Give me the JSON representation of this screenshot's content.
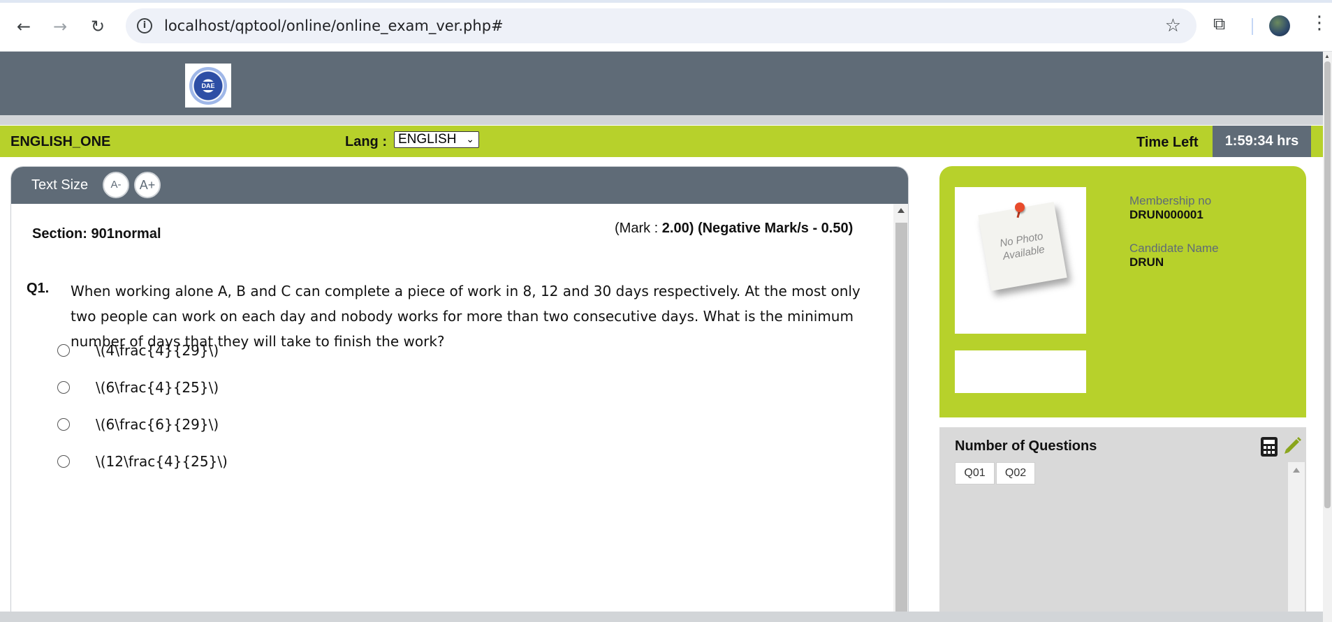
{
  "browser": {
    "url": "localhost/qptool/online/online_exam_ver.php#"
  },
  "header": {
    "logo_text": "DAE"
  },
  "exam_bar": {
    "exam_name": "ENGLISH_ONE",
    "lang_label": "Lang :",
    "lang_value": "ENGLISH",
    "time_left_label": "Time Left",
    "time_left_value": "1:59:34 hrs"
  },
  "question_panel": {
    "text_size_label": "Text Size",
    "decrease_label": "A-",
    "increase_label": "A+",
    "section": "Section: 901normal",
    "mark_prefix": "(Mark : ",
    "mark_value": "2.00)",
    "negative_mark": "(Negative Mark/s - 0.50)",
    "question_number": "Q1.",
    "question_text": "When working alone A, B and C can complete a piece of work in 8, 12 and 30 days respectively. At the most only two people can work on each day and nobody works for more than two consecutive days. What is the minimum number of days that they will take to finish the work?",
    "options": [
      "\\(4\\frac{4}{29}\\)",
      "\\(6\\frac{4}{25}\\)",
      "\\(6\\frac{6}{29}\\)",
      "\\(12\\frac{4}{25}\\)"
    ]
  },
  "candidate": {
    "photo_text": "No Photo Available",
    "membership_label": "Membership no",
    "membership_value": "DRUN000001",
    "name_label": "Candidate Name",
    "name_value": "DRUN"
  },
  "question_nav": {
    "title": "Number of Questions",
    "questions": [
      "Q01",
      "Q02"
    ]
  },
  "colors": {
    "accent_green": "#b7d12b",
    "slate": "#5f6b77"
  }
}
